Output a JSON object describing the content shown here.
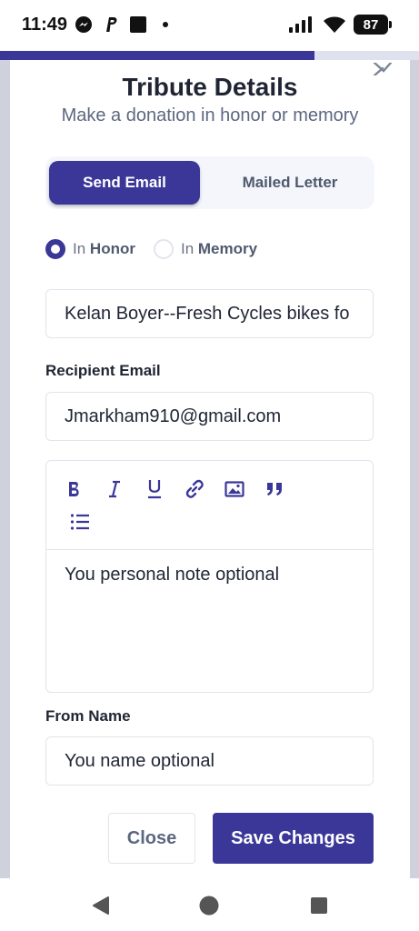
{
  "status_bar": {
    "time": "11:49",
    "battery": "87",
    "left_icons": [
      "messenger-icon",
      "paypal-icon",
      "square-app-icon",
      "notification-dot-icon"
    ],
    "right_icons": [
      "signal-icon",
      "wifi-icon",
      "battery-icon"
    ]
  },
  "progress": {
    "fraction": 0.75,
    "color": "#3a3799"
  },
  "modal": {
    "title": "Tribute Details",
    "subtitle": "Make a donation in honor or memory",
    "tabs": [
      {
        "label": "Send Email",
        "active": true
      },
      {
        "label": "Mailed Letter",
        "active": false
      }
    ],
    "tribute_type": {
      "options": [
        {
          "prefix": "In",
          "label": "Honor",
          "checked": true
        },
        {
          "prefix": "In",
          "label": "Memory",
          "checked": false
        }
      ]
    },
    "honoree_field": {
      "value": "Kelan Boyer--Fresh Cycles bikes fo"
    },
    "recipient_email": {
      "label": "Recipient Email",
      "value": "Jmarkham910@gmail.com"
    },
    "note_editor": {
      "toolbar": [
        "bold-icon",
        "italic-icon",
        "underline-icon",
        "link-icon",
        "image-icon",
        "quote-icon",
        "bullet-list-icon"
      ],
      "placeholder": "You personal note optional"
    },
    "from_name": {
      "label": "From Name",
      "placeholder": "You name optional"
    },
    "close_label": "Close",
    "save_label": "Save Changes"
  },
  "nav_bar": {
    "icons": [
      "back-icon",
      "home-icon",
      "recents-icon"
    ]
  },
  "colors": {
    "accent": "#3a3799",
    "backdrop": "#cfd2dd",
    "muted_text": "#5c6780"
  }
}
